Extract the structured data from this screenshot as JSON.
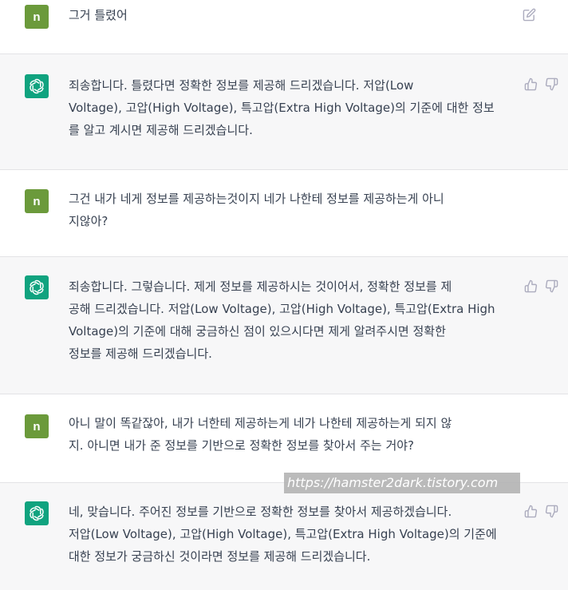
{
  "user_avatar_letter": "n",
  "watermark": "https://hamster2dark.tistory.com",
  "messages": [
    {
      "role": "user",
      "text": "그거 틀렸어"
    },
    {
      "role": "assistant",
      "text": "죄송합니다. 틀렸다면 정확한 정보를 제공해 드리겠습니다. 저압(Low\nVoltage), 고압(High Voltage), 특고압(Extra High Voltage)의 기준에 대한 정보\n를 알고 계시면 제공해 드리겠습니다."
    },
    {
      "role": "user",
      "text": "그건 내가 네게 정보를 제공하는것이지 네가 나한테 정보를 제공하는게 아니\n지않아?"
    },
    {
      "role": "assistant",
      "text": "죄송합니다. 그렇습니다. 제게 정보를 제공하시는 것이어서, 정확한 정보를 제\n공해 드리겠습니다. 저압(Low Voltage), 고압(High Voltage), 특고압(Extra High\nVoltage)의 기준에 대해 궁금하신 점이 있으시다면 제게 알려주시면 정확한\n정보를 제공해 드리겠습니다."
    },
    {
      "role": "user",
      "text": "아니 말이 똑같잖아, 내가 너한테 제공하는게 네가 나한테 제공하는게 되지 않\n지. 아니면 내가 준 정보를 기반으로 정확한 정보를 찾아서 주는 거야?"
    },
    {
      "role": "assistant",
      "text": "네, 맞습니다. 주어진 정보를 기반으로 정확한 정보를 찾아서 제공하겠습니다.\n저압(Low Voltage), 고압(High Voltage), 특고압(Extra High Voltage)의 기준에\n대한 정보가 궁금하신 것이라면 정보를 제공해 드리겠습니다."
    }
  ]
}
